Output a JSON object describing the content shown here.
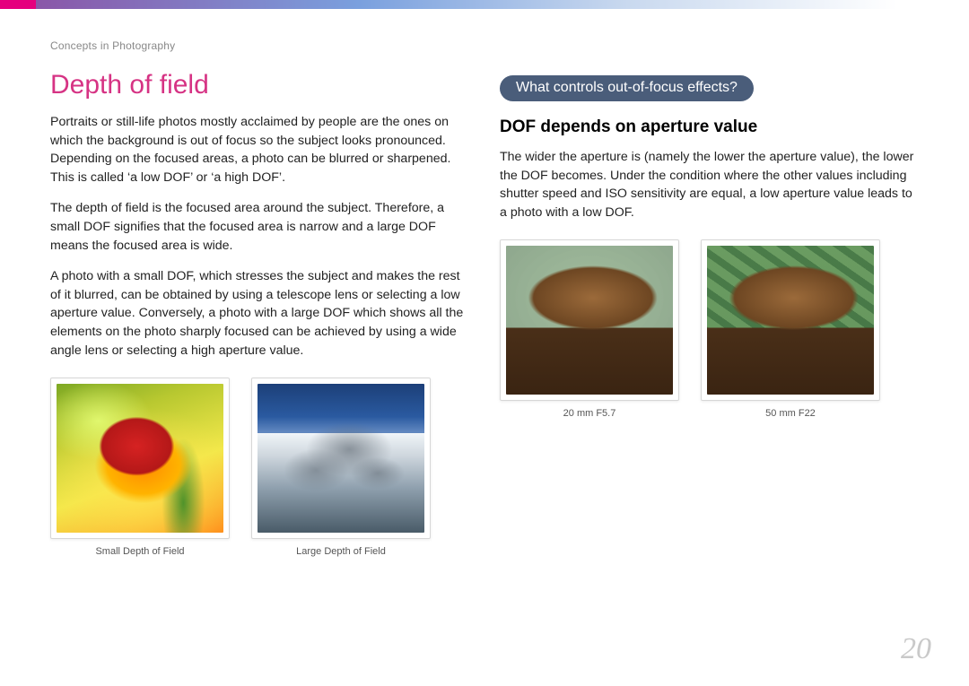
{
  "breadcrumb": "Concepts in Photography",
  "page_number": "20",
  "left": {
    "title": "Depth of field",
    "p1": "Portraits or still-life photos mostly acclaimed by people are the ones on which the background is out of focus so the subject looks pronounced. Depending on the focused areas, a photo can be blurred or sharpened. This is called ‘a low DOF’ or ‘a high DOF’.",
    "p2": "The depth of field is the focused area around the subject. Therefore, a small DOF signifies that the focused area is narrow and a large DOF means the focused area is wide.",
    "p3": "A photo with a small DOF, which stresses the subject and makes the rest of it blurred, can be obtained by using a telescope lens or selecting a low aperture value. Conversely, a photo with a large DOF which shows all the elements on the photo sharply focused can be achieved by using a wide angle lens or selecting a high aperture value.",
    "figs": [
      {
        "caption": "Small Depth of Field",
        "icon": "tulip-photo"
      },
      {
        "caption": "Large Depth of Field",
        "icon": "mountain-photo"
      }
    ]
  },
  "right": {
    "pill": "What controls out-of-focus effects?",
    "sub": "DOF depends on aperture value",
    "p1": "The wider the aperture is (namely the lower the aperture value), the lower the DOF becomes. Under the condition where the other values including shutter speed and ISO sensitivity are equal, a low aperture value leads to a photo with a low DOF.",
    "figs": [
      {
        "caption": "20 mm F5.7",
        "icon": "grinder-blurred-bg-photo"
      },
      {
        "caption": "50 mm F22",
        "icon": "grinder-sharp-bg-photo"
      }
    ]
  }
}
